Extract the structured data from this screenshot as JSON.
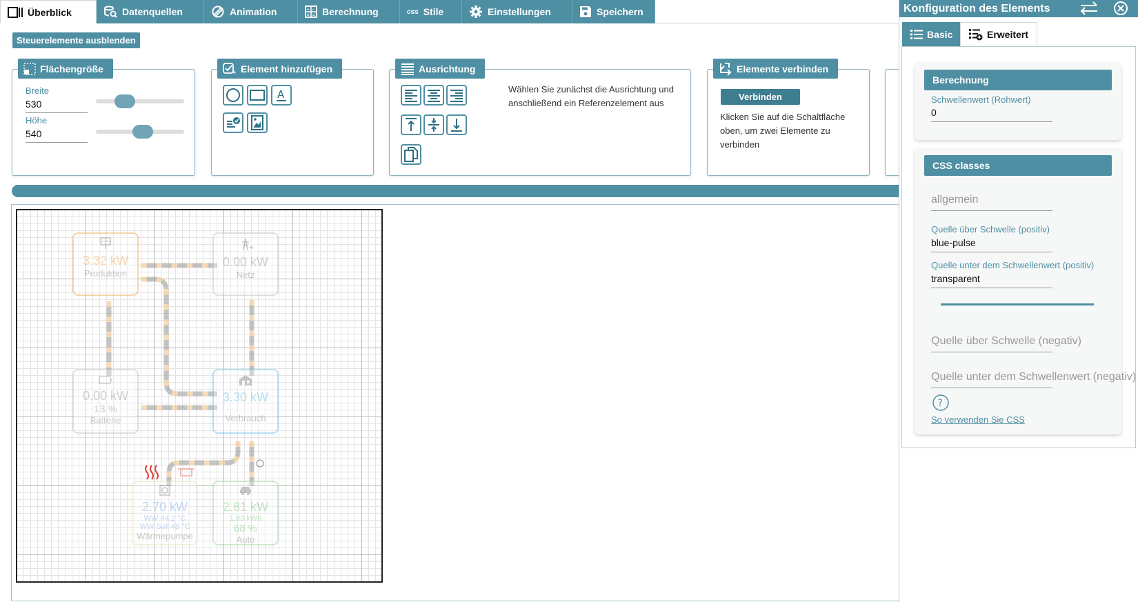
{
  "tabs": [
    {
      "label": "Überblick",
      "icon": "overview-icon"
    },
    {
      "label": "Datenquellen",
      "icon": "datasource-icon"
    },
    {
      "label": "Animation",
      "icon": "animation-icon"
    },
    {
      "label": "Berechnung",
      "icon": "calculator-icon"
    },
    {
      "label": "Stile",
      "icon": "css-icon",
      "prefix": "css"
    },
    {
      "label": "Einstellungen",
      "icon": "gear-icon"
    },
    {
      "label": "Speichern",
      "icon": "save-icon"
    }
  ],
  "toolbar": {
    "hide_controls": "Steuerelemente ausblenden"
  },
  "size_card": {
    "title": "Flächengröße",
    "width_label": "Breite",
    "width_value": "530",
    "height_label": "Höhe",
    "height_value": "540"
  },
  "add_card": {
    "title": "Element hinzufügen"
  },
  "align_card": {
    "title": "Ausrichtung",
    "hint": "Wählen Sie zunächst die Ausrichtung und anschließend ein Referenzelement aus"
  },
  "connect_card": {
    "title": "Elemente verbinden",
    "button": "Verbinden",
    "hint": "Klicken Sie auf die Schaltfläche oben, um zwei Elemente zu verbinden"
  },
  "canvas": {
    "nodes": {
      "production": {
        "value": "3.32 kW",
        "label": "Produktion"
      },
      "grid": {
        "value": "0.00 kW",
        "label": "Netz"
      },
      "battery": {
        "value": "0.00 kW",
        "percent": "13 %",
        "label": "Batterie"
      },
      "consumption": {
        "value": "3.30 kW",
        "label": "Verbrauch"
      },
      "heatpump": {
        "value": "2.70 kW",
        "line1": "WW 44.2 °C",
        "line2": "WW Soll 48 °C",
        "label": "Wärmepumpe"
      },
      "car": {
        "value": "2.81 kW",
        "energy": "1.83 kWh",
        "percent": "68 %",
        "label": "Auto"
      }
    }
  },
  "panel": {
    "title": "Konfiguration des Elements",
    "tab_basic": "Basic",
    "tab_advanced": "Erweitert",
    "calc": {
      "title": "Berechnung",
      "threshold_label": "Schwellenwert (Rohwert)",
      "threshold_value": "0"
    },
    "css": {
      "title": "CSS classes",
      "general_placeholder": "allgemein",
      "above_pos_label": "Quelle über Schwelle (positiv)",
      "above_pos_value": "blue-pulse",
      "below_pos_label": "Quelle unter dem Schwellenwert (positiv)",
      "below_pos_value": "transparent",
      "above_neg_placeholder": "Quelle über Schwelle (negativ)",
      "below_neg_placeholder": "Quelle unter dem Schwellenwert (negativ)",
      "help_link": "So verwenden Sie CSS"
    }
  },
  "colors": {
    "accent": "#4f8fa3",
    "production": "#f2b36b",
    "consumption": "#7fc7e6",
    "heatpump": "#b8cde8",
    "car": "#a8d8a8",
    "heater": "#e53935"
  }
}
